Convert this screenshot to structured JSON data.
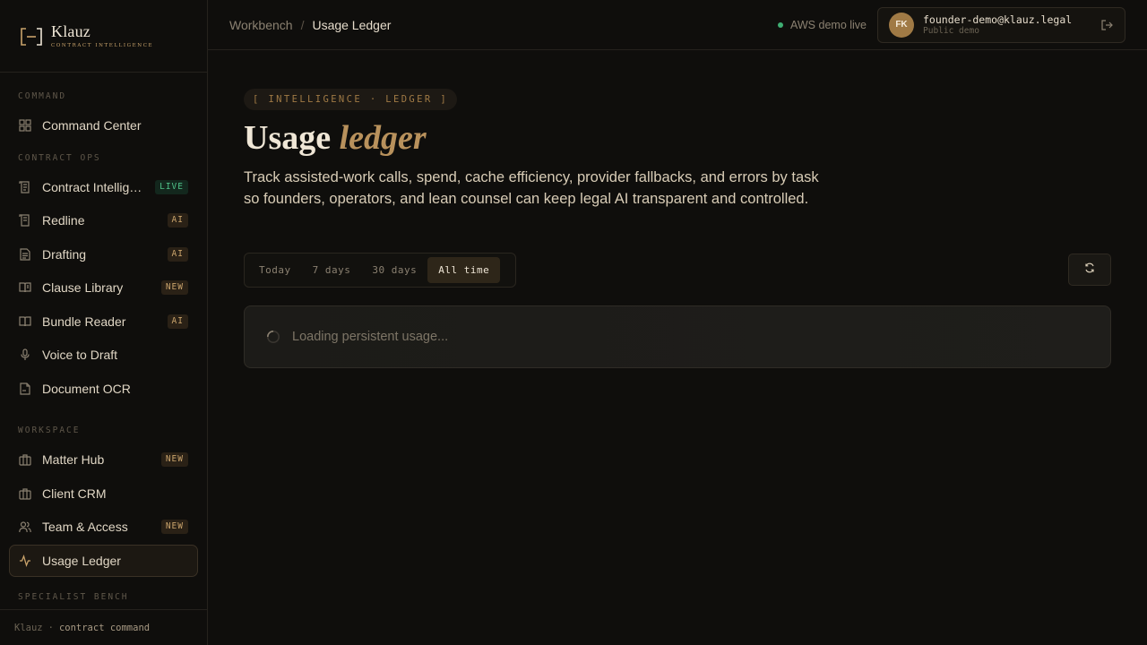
{
  "brand": {
    "name": "Klauz",
    "tagline": "Contract Intelligence"
  },
  "sidebar": {
    "sections": [
      {
        "label": "Command"
      },
      {
        "label": "Contract Ops"
      },
      {
        "label": "Workspace"
      },
      {
        "label": "Specialist Bench"
      }
    ],
    "items": [
      {
        "label": "Command Center",
        "icon": "grid-icon",
        "badge": ""
      },
      {
        "label": "Contract Intelligence",
        "icon": "document-scan-icon",
        "badge": "LIVE"
      },
      {
        "label": "Redline",
        "icon": "document-edit-icon",
        "badge": "AI"
      },
      {
        "label": "Drafting",
        "icon": "document-lines-icon",
        "badge": "AI"
      },
      {
        "label": "Clause Library",
        "icon": "book-open-icon",
        "badge": "NEW"
      },
      {
        "label": "Bundle Reader",
        "icon": "book-icon",
        "badge": "AI"
      },
      {
        "label": "Voice to Draft",
        "icon": "microphone-icon",
        "badge": ""
      },
      {
        "label": "Document OCR",
        "icon": "document-icon",
        "badge": ""
      },
      {
        "label": "Matter Hub",
        "icon": "briefcase-icon",
        "badge": "NEW"
      },
      {
        "label": "Client CRM",
        "icon": "briefcase-icon",
        "badge": ""
      },
      {
        "label": "Team & Access",
        "icon": "users-icon",
        "badge": "NEW"
      },
      {
        "label": "Usage Ledger",
        "icon": "activity-icon",
        "badge": ""
      }
    ],
    "footer": {
      "brand": "Klauz",
      "sep": "·",
      "text": "contract command"
    }
  },
  "topbar": {
    "breadcrumb": [
      "Workbench",
      "Usage Ledger"
    ],
    "breadcrumb_sep": "/",
    "status": "AWS demo live",
    "user": {
      "initials": "FK",
      "email": "founder-demo@klauz.legal",
      "role": "Public demo"
    }
  },
  "main": {
    "eyebrow": "[ INTELLIGENCE · LEDGER ]",
    "title_plain": "Usage",
    "title_accent": "ledger",
    "description": "Track assisted-work calls, spend, cache efficiency, provider fallbacks, and errors by task so founders, operators, and lean counsel can keep legal AI transparent and controlled.",
    "ranges": [
      "Today",
      "7 days",
      "30 days",
      "All time"
    ],
    "selected_range": "All time",
    "loading_text": "Loading persistent usage..."
  },
  "colors": {
    "accent": "#c9a36b",
    "live": "#3fae73",
    "background": "#0f0e0c"
  }
}
